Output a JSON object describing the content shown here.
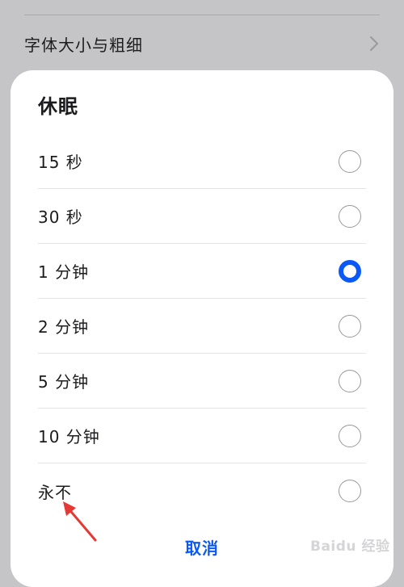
{
  "background": {
    "row_label": "字体大小与粗细",
    "chevron_icon": "chevron-right-icon"
  },
  "dialog": {
    "title": "休眠",
    "options": [
      {
        "label": "15 秒",
        "selected": false
      },
      {
        "label": "30 秒",
        "selected": false
      },
      {
        "label": "1 分钟",
        "selected": true
      },
      {
        "label": "2 分钟",
        "selected": false
      },
      {
        "label": "5 分钟",
        "selected": false
      },
      {
        "label": "10 分钟",
        "selected": false
      },
      {
        "label": "永不",
        "selected": false
      }
    ],
    "cancel_label": "取消"
  },
  "annotation": {
    "icon": "red-arrow-icon",
    "color": "#e53935"
  },
  "colors": {
    "accent": "#0a59f7"
  },
  "watermark": {
    "text": "Baidu 经验"
  }
}
